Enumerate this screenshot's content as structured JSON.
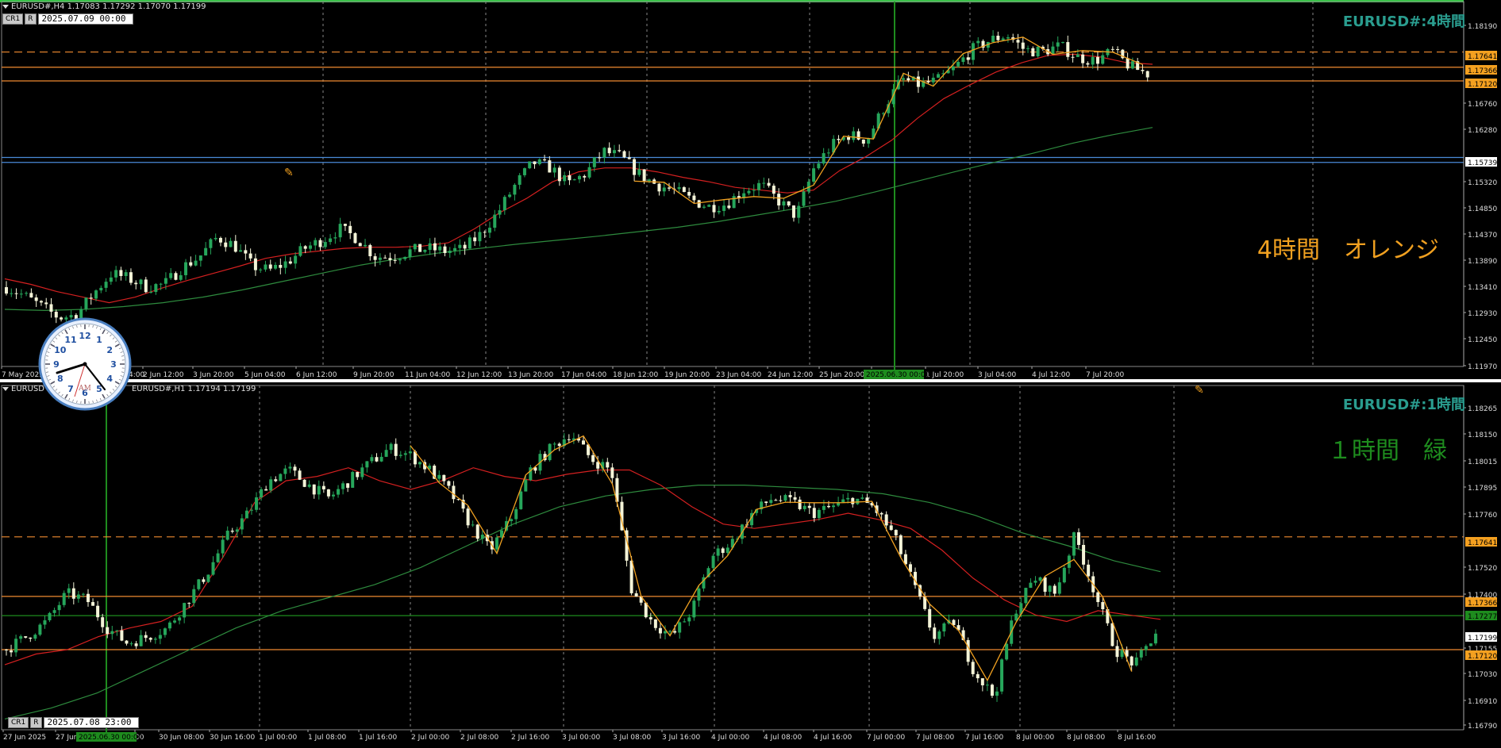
{
  "top": {
    "header": "EURUSD#,H4  1.17083 1.17292 1.17070 1.17199",
    "buttons": [
      "CR1",
      "R"
    ],
    "datetime": "2025.07.09 00:00",
    "title_right": "EURUSD#:4時間",
    "label_big": "4時間　オレンジ",
    "axis_prices": [
      "1.18190",
      "1.17641",
      "1.17366",
      "1.17120",
      "1.16760",
      "1.16280",
      "1.15739",
      "1.15320",
      "1.14850",
      "1.14370",
      "1.13890",
      "1.13410",
      "1.12930",
      "1.12450",
      "1.11970"
    ],
    "time_labels": [
      "7 May 2025",
      "2 Jun 12:00",
      "3 Jun 20:00",
      "5 Jun 04:00",
      "6 Jun 12:00",
      "9 Jun 20:00",
      "11 Jun 04:00",
      "12 Jun 12:00",
      "13 Jun 20:00",
      "17 Jun 04:00",
      "18 Jun 12:00",
      "19 Jun 20:00",
      "23 Jun 04:00",
      "24 Jun 12:00",
      "25 Jun 20:00",
      "Jun 12:00",
      "1 Jul 20:00",
      "3 Jul 04:00",
      "4 Jul 12:00",
      "7 Jul 20:00"
    ],
    "time_cursor_label": "2025.06.30 00:00",
    "partial_time_label": "4:00"
  },
  "bottom": {
    "header": "EURUSD#,H1  1.17194 1.17199",
    "header_prefix": "EURUSD",
    "buttons": [
      "CR1",
      "R"
    ],
    "datetime": "2025.07.08 23:00",
    "title_right": "EURUSD#:1時間",
    "label_big": "１時間　緑",
    "axis_prices": [
      "1.18265",
      "1.18150",
      "1.18015",
      "1.17895",
      "1.17760",
      "1.17641",
      "1.17520",
      "1.17400",
      "1.17366",
      "1.17277",
      "1.17199",
      "1.17155",
      "1.17120",
      "1.17030",
      "1.16910",
      "1.16790"
    ],
    "time_labels": [
      "27 Jun 2025",
      "27 Jun",
      "00",
      "30 Jun 08:00",
      "30 Jun 16:00",
      "1 Jul 00:00",
      "1 Jul 08:00",
      "1 Jul 16:00",
      "2 Jul 00:00",
      "2 Jul 08:00",
      "2 Jul 16:00",
      "3 Jul 00:00",
      "3 Jul 08:00",
      "3 Jul 16:00",
      "4 Jul 00:00",
      "4 Jul 08:00",
      "4 Jul 16:00",
      "7 Jul 00:00",
      "7 Jul 08:00",
      "7 Jul 16:00",
      "8 Jul 00:00",
      "8 Jul 08:00",
      "8 Jul 16:00"
    ],
    "time_cursor_label": "2025.06.30 00:00"
  },
  "clock": {
    "numbers": [
      "12",
      "1",
      "2",
      "3",
      "4",
      "5",
      "6",
      "7",
      "8",
      "9",
      "10",
      "11"
    ],
    "ampm": "AM"
  },
  "colors": {
    "bull": "#26a65b",
    "bear": "#f4f4d8",
    "ma_red": "#d42020",
    "ma_green": "#2e8b3e",
    "zigzag": "#f0a020",
    "level_orange": "#f08a30",
    "level_blue": "#4a8ad8",
    "cursor_green": "#1e8c1e",
    "title_teal": "#2a9d8f",
    "label_orange": "#f0a020",
    "label_green": "#1e8c1e",
    "grid": "#888888",
    "ask_label": "#f4a020"
  },
  "chart_data": [
    {
      "type": "line",
      "title": "EURUSD#:4時間",
      "ylim": [
        1.1197,
        1.1855
      ],
      "levels": [
        1.17641,
        1.17366,
        1.1712,
        1.15739,
        1.1565
      ],
      "close_path": [
        1.134,
        1.1325,
        1.1305,
        1.1285,
        1.129,
        1.133,
        1.1365,
        1.1355,
        1.134,
        1.1345,
        1.1375,
        1.1395,
        1.143,
        1.1415,
        1.1378,
        1.137,
        1.1385,
        1.141,
        1.1425,
        1.1445,
        1.1428,
        1.1395,
        1.1395,
        1.1405,
        1.141,
        1.1405,
        1.1408,
        1.1435,
        1.1475,
        1.1525,
        1.1565,
        1.1555,
        1.1525,
        1.1545,
        1.1585,
        1.1575,
        1.1545,
        1.1525,
        1.1515,
        1.1498,
        1.1485,
        1.149,
        1.1515,
        1.1525,
        1.1495,
        1.1468,
        1.1555,
        1.1595,
        1.1615,
        1.1605,
        1.1665,
        1.1715,
        1.1705,
        1.1712,
        1.1735,
        1.1768,
        1.1785,
        1.1795,
        1.1768,
        1.1765,
        1.1775,
        1.1755,
        1.1748,
        1.1765,
        1.1738,
        1.1725
      ],
      "ma_red_path": [
        1.1355,
        1.1345,
        1.1332,
        1.1322,
        1.1312,
        1.1322,
        1.1338,
        1.1352,
        1.1365,
        1.1378,
        1.1392,
        1.14,
        1.1405,
        1.141,
        1.1412,
        1.1412,
        1.1414,
        1.142,
        1.1445,
        1.1475,
        1.15,
        1.153,
        1.1548,
        1.1555,
        1.1555,
        1.1548,
        1.1538,
        1.153,
        1.152,
        1.1515,
        1.151,
        1.1515,
        1.155,
        1.1575,
        1.1605,
        1.1645,
        1.168,
        1.1705,
        1.1728,
        1.1745,
        1.1758,
        1.176,
        1.1755,
        1.1745,
        1.1742
      ],
      "ma_green_path": [
        1.13,
        1.1298,
        1.13,
        1.1305,
        1.1312,
        1.1322,
        1.1335,
        1.135,
        1.1365,
        1.138,
        1.1392,
        1.1402,
        1.141,
        1.1418,
        1.1425,
        1.1432,
        1.144,
        1.1448,
        1.1458,
        1.147,
        1.1482,
        1.1495,
        1.1512,
        1.153,
        1.1548,
        1.1565,
        1.1582,
        1.16,
        1.1615,
        1.1628
      ]
    },
    {
      "type": "line",
      "title": "EURUSD#:1時間",
      "ylim": [
        1.1675,
        1.1834
      ],
      "levels": [
        1.17641,
        1.17366,
        1.1712,
        1.17277
      ],
      "close_path": [
        1.1712,
        1.1718,
        1.1725,
        1.1738,
        1.1735,
        1.1722,
        1.1715,
        1.1718,
        1.1722,
        1.1735,
        1.1748,
        1.1765,
        1.1775,
        1.179,
        1.1795,
        1.1788,
        1.1782,
        1.179,
        1.1798,
        1.1805,
        1.1802,
        1.1795,
        1.1785,
        1.177,
        1.1758,
        1.1772,
        1.1795,
        1.1805,
        1.1812,
        1.18,
        1.1795,
        1.174,
        1.1725,
        1.1718,
        1.173,
        1.1755,
        1.1762,
        1.1775,
        1.1782,
        1.178,
        1.1775,
        1.1778,
        1.1782,
        1.1778,
        1.1765,
        1.1742,
        1.1718,
        1.1725,
        1.1702,
        1.169,
        1.173,
        1.1745,
        1.1738,
        1.1765,
        1.1738,
        1.1712,
        1.1705,
        1.172
      ],
      "ma_red_path": [
        1.1705,
        1.171,
        1.1712,
        1.1718,
        1.1722,
        1.1725,
        1.1732,
        1.1755,
        1.178,
        1.179,
        1.1792,
        1.1796,
        1.179,
        1.1786,
        1.179,
        1.1796,
        1.1792,
        1.179,
        1.1793,
        1.1795,
        1.1795,
        1.1788,
        1.1778,
        1.177,
        1.1768,
        1.177,
        1.1772,
        1.1775,
        1.1772,
        1.1768,
        1.1758,
        1.1745,
        1.1735,
        1.1728,
        1.1725,
        1.173,
        1.1728,
        1.1726
      ],
      "ma_green_path": [
        1.168,
        1.1685,
        1.1692,
        1.1702,
        1.1712,
        1.1722,
        1.173,
        1.1736,
        1.1742,
        1.175,
        1.176,
        1.177,
        1.1778,
        1.1783,
        1.1786,
        1.1788,
        1.1788,
        1.1787,
        1.1786,
        1.1784,
        1.178,
        1.1774,
        1.1766,
        1.176,
        1.1753,
        1.1748
      ]
    }
  ]
}
